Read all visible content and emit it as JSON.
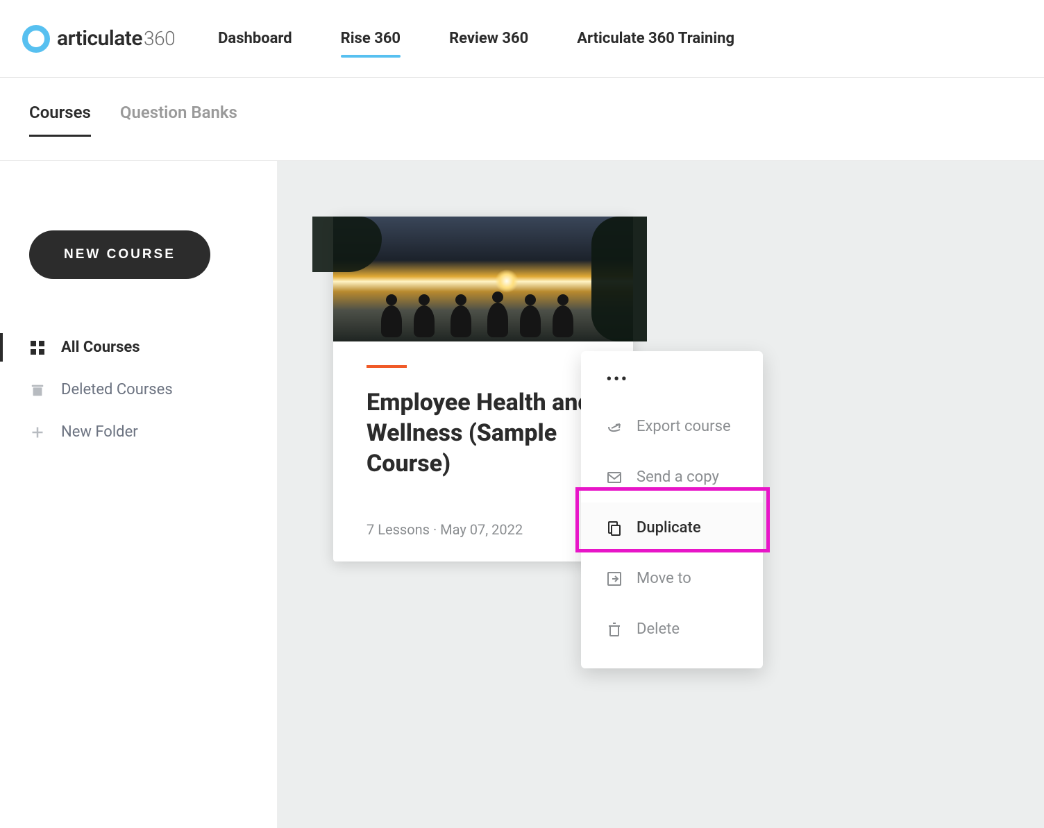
{
  "brand": {
    "word": "articulate",
    "suffix": "360"
  },
  "nav": {
    "items": [
      {
        "label": "Dashboard"
      },
      {
        "label": "Rise 360",
        "active": true
      },
      {
        "label": "Review 360"
      },
      {
        "label": "Articulate 360 Training"
      }
    ]
  },
  "subtabs": {
    "items": [
      {
        "label": "Courses",
        "active": true
      },
      {
        "label": "Question Banks"
      }
    ]
  },
  "sidebar": {
    "new_course_label": "NEW COURSE",
    "items": [
      {
        "label": "All Courses",
        "icon": "grid",
        "active": true
      },
      {
        "label": "Deleted Courses",
        "icon": "trash"
      },
      {
        "label": "New Folder",
        "icon": "plus"
      }
    ]
  },
  "course": {
    "title": "Employee Health and Wellness (Sample Course)",
    "meta": "7 Lessons · May 07, 2022",
    "accent_color": "#f05a28"
  },
  "context_menu": {
    "items": [
      {
        "label": "Export course",
        "icon": "share"
      },
      {
        "label": "Send a copy",
        "icon": "mail"
      },
      {
        "label": "Duplicate",
        "icon": "copy",
        "emphasized": true
      },
      {
        "label": "Move to",
        "icon": "move"
      },
      {
        "label": "Delete",
        "icon": "trash"
      }
    ]
  }
}
